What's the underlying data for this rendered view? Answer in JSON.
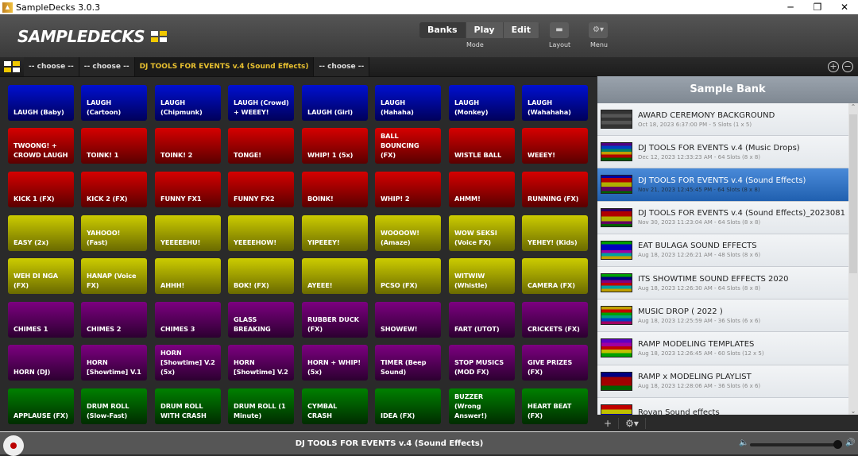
{
  "window": {
    "title": "SampleDecks 3.0.3",
    "app_icon": "waveform-icon"
  },
  "header": {
    "logo": "SAMPLEDECKS",
    "mode_tabs": [
      "Banks",
      "Play",
      "Edit"
    ],
    "active_mode": "Banks",
    "mode_label": "Mode",
    "layout_label": "Layout",
    "menu_label": "Menu"
  },
  "tabs": [
    "-- choose --",
    "-- choose --",
    "DJ TOOLS FOR EVENTS v.4 (Sound Effects)",
    "-- choose --"
  ],
  "active_tab": 2,
  "colors": {
    "blue": "#0010d0",
    "red": "#d60000",
    "yellow": "#cccc00",
    "purple": "#7c0080",
    "green": "#008000",
    "accent": "#e8c030",
    "selection": "#3a7ac8"
  },
  "pads": [
    {
      "color": "blue",
      "labels": [
        "LAUGH (Baby)",
        "LAUGH (Cartoon)",
        "LAUGH (Chipmunk)",
        "LAUGH (Crowd) + WEEEY!",
        "LAUGH (Girl)",
        "LAUGH (Hahaha)",
        "LAUGH (Monkey)",
        "LAUGH (Wahahaha)"
      ]
    },
    {
      "color": "red",
      "labels": [
        "TWOONG! + CROWD LAUGH",
        "TOINK! 1",
        "TOINK! 2",
        "TONGE!",
        "WHIP! 1 (5x)",
        "BALL BOUNCING (FX)",
        "WISTLE BALL",
        "WEEEY!"
      ]
    },
    {
      "color": "red",
      "labels": [
        "KICK 1 (FX)",
        "KICK 2 (FX)",
        "FUNNY FX1",
        "FUNNY FX2",
        "BOINK!",
        "WHIP! 2",
        "AHMM!",
        "RUNNING (FX)"
      ]
    },
    {
      "color": "yellow",
      "labels": [
        "EASY (2x)",
        "YAHOOO! (Fast)",
        "YEEEEEHU!",
        "YEEEEHOW!",
        "YIPEEEY!",
        "WOOOOW! (Amaze)",
        "WOW SEKSI (Voice FX)",
        "YEHEY! (Kids)"
      ]
    },
    {
      "color": "yellow",
      "labels": [
        "WEH DI NGA (FX)",
        "HANAP (Voice FX)",
        "AHHH!",
        "BOK! (FX)",
        "AYEEE!",
        "PCSO (FX)",
        "WITWIW (Whistle)",
        "CAMERA (FX)"
      ]
    },
    {
      "color": "purple",
      "labels": [
        "CHIMES 1",
        "CHIMES 2",
        "CHIMES 3",
        "GLASS BREAKING",
        "RUBBER DUCK (FX)",
        "SHOWEW!",
        "FART (UTOT)",
        "CRICKETS (FX)"
      ]
    },
    {
      "color": "purple",
      "labels": [
        "HORN (DJ)",
        "HORN [Showtime] V.1",
        "HORN [Showtime] V.2 (5x)",
        "HORN [Showtime] V.2",
        "HORN + WHIP! (5x)",
        "TIMER (Beep Sound)",
        "STOP MUSICS (MOD FX)",
        "GIVE PRIZES (FX)"
      ]
    },
    {
      "color": "green",
      "labels": [
        "APPLAUSE (FX)",
        "DRUM ROLL (Slow-Fast)",
        "DRUM ROLL WITH CRASH",
        "DRUM ROLL (1 Minute)",
        "CYMBAL CRASH",
        "IDEA (FX)",
        "BUZZER (Wrong Answer!)",
        "HEART BEAT (FX)"
      ]
    }
  ],
  "sample_bank": {
    "title": "Sample Bank",
    "selected": 2,
    "items": [
      {
        "name": "AWARD CEREMONY  BACKGROUND",
        "info": "Oct 18, 2023 6:37:00 PM - 5 Slots (1 x 5)",
        "stripes": [
          "#333",
          "#555",
          "#333",
          "#555",
          "#333"
        ]
      },
      {
        "name": "DJ TOOLS FOR EVENTS v.4 (Music Drops)",
        "info": "Dec 12, 2023 12:33:23 AM - 64 Slots (8 x 8)",
        "stripes": [
          "#500080",
          "#0040c0",
          "#008060",
          "#c0a000",
          "#b00000",
          "#006000"
        ]
      },
      {
        "name": "DJ TOOLS FOR EVENTS v.4 (Sound Effects)",
        "info": "Nov 21, 2023 12:45:45 PM - 64 Slots (8 x 8)",
        "stripes": [
          "#0000a0",
          "#b00000",
          "#b00000",
          "#b0b000",
          "#b0b000",
          "#600060",
          "#600060",
          "#006000"
        ]
      },
      {
        "name": "DJ TOOLS FOR EVENTS v.4 (Sound Effects)_2023081",
        "info": "Nov 30, 2023 11:23:04 AM - 64 Slots (8 x 8)",
        "stripes": [
          "#300060",
          "#b00000",
          "#b00000",
          "#b0b000",
          "#b0b000",
          "#600060",
          "#006000"
        ]
      },
      {
        "name": "EAT BULAGA SOUND EFFECTS",
        "info": "Aug 18, 2023 12:26:21 AM - 48 Slots (8 x 6)",
        "stripes": [
          "#00a000",
          "#0000c0",
          "#0000c0",
          "#a000a0",
          "#00a0a0",
          "#c0a000"
        ]
      },
      {
        "name": "ITS SHOWTIME SOUND EFFECTS 2020",
        "info": "Aug 18, 2023 12:26:30 AM - 64 Slots (8 x 8)",
        "stripes": [
          "#00a000",
          "#000080",
          "#800080",
          "#c00000",
          "#00a0a0",
          "#c0a000"
        ]
      },
      {
        "name": "MUSIC DROP ( 2022 )",
        "info": "Aug 18, 2023 12:25:59 AM - 36 Slots (6 x 6)",
        "stripes": [
          "#c0a000",
          "#c00000",
          "#00a000",
          "#00a080",
          "#0040c0",
          "#a00060"
        ]
      },
      {
        "name": "RAMP MODELING TEMPLATES",
        "info": "Aug 18, 2023 12:26:45 AM - 60 Slots (12 x 5)",
        "stripes": [
          "#6000c0",
          "#a000a0",
          "#c00000",
          "#c0c000",
          "#00a000"
        ]
      },
      {
        "name": "RAMP x MODELING PLAYLIST",
        "info": "Aug 18, 2023 12:28:06 AM - 36 Slots (6 x 6)",
        "stripes": [
          "#000080",
          "#a00000",
          "#a00000",
          "#006000"
        ]
      },
      {
        "name": "Rovan Sound effects",
        "info": "",
        "stripes": [
          "#c00000",
          "#c0c000",
          "#0000a0",
          "#80c0c0"
        ]
      }
    ],
    "tools": [
      "+",
      "⚙▾"
    ]
  },
  "status": {
    "now_playing": "DJ TOOLS FOR EVENTS v.4 (Sound Effects)",
    "volume": 0.96
  }
}
